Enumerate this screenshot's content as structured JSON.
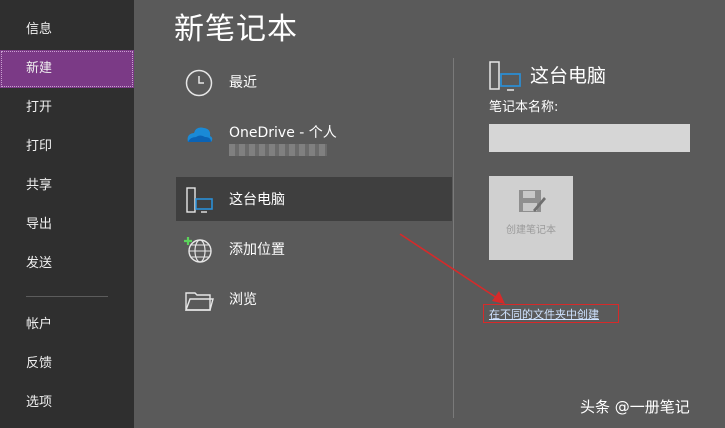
{
  "sidebar": {
    "items": [
      {
        "label": "信息"
      },
      {
        "label": "新建"
      },
      {
        "label": "打开"
      },
      {
        "label": "打印"
      },
      {
        "label": "共享"
      },
      {
        "label": "导出"
      },
      {
        "label": "发送"
      },
      {
        "label": "帐户"
      },
      {
        "label": "反馈"
      },
      {
        "label": "选项"
      }
    ],
    "active_index": 1,
    "active_color": "#7b3a86"
  },
  "main": {
    "title": "新笔记本",
    "places": [
      {
        "label": "最近",
        "icon": "clock-icon"
      },
      {
        "label": "OneDrive - 个人",
        "icon": "cloud-icon"
      },
      {
        "label": "这台电脑",
        "icon": "computer-icon",
        "selected": true
      },
      {
        "label": "添加位置",
        "icon": "globe-add-icon"
      },
      {
        "label": "浏览",
        "icon": "folder-icon"
      }
    ]
  },
  "detail": {
    "title": "这台电脑",
    "name_label": "笔记本名称:",
    "name_value": "",
    "create_label": "创建笔记本",
    "alt_link": "在不同的文件夹中创建"
  },
  "watermark": "头条 @一册笔记",
  "colors": {
    "annotation": "#d62a2a",
    "link": "#cfe3ff"
  }
}
